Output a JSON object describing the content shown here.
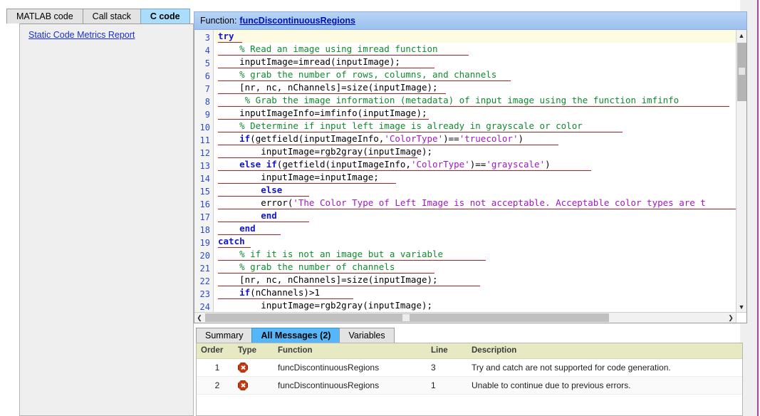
{
  "left_panel": {
    "tabs": [
      {
        "label": "MATLAB code",
        "active": false
      },
      {
        "label": "Call stack",
        "active": false
      },
      {
        "label": "C code",
        "active": true
      }
    ],
    "link": "Static Code Metrics Report"
  },
  "code_panel": {
    "header_prefix": "Function:",
    "function_name": "funcDiscontinuousRegions",
    "first_line_number": 3,
    "lines": [
      {
        "n": 3,
        "current": true,
        "underline": 34,
        "tokens": [
          {
            "t": "kw",
            "v": "try"
          }
        ]
      },
      {
        "n": 4,
        "current": false,
        "underline": 352,
        "tokens": [
          {
            "t": "cmt",
            "v": "    % Read an image using imread function"
          }
        ]
      },
      {
        "n": 5,
        "current": false,
        "underline": 304,
        "tokens": [
          {
            "t": "txt",
            "v": "    inputImage=imread(inputImage);"
          }
        ]
      },
      {
        "n": 6,
        "current": false,
        "underline": 411,
        "tokens": [
          {
            "t": "cmt",
            "v": "    % grab the number of rows, columns, and channels"
          }
        ]
      },
      {
        "n": 7,
        "current": false,
        "underline": 320,
        "tokens": [
          {
            "t": "txt",
            "v": "    [nr, nc, nChannels]=size(inputImage);"
          }
        ]
      },
      {
        "n": 8,
        "current": false,
        "underline": 718,
        "tokens": [
          {
            "t": "cmt",
            "v": "     % Grab the image information (metadata) of input image using the function imfinfo"
          }
        ]
      },
      {
        "n": 9,
        "current": false,
        "underline": 296,
        "tokens": [
          {
            "t": "txt",
            "v": "    inputImageInfo=imfinfo(inputImage);"
          }
        ]
      },
      {
        "n": 10,
        "current": false,
        "underline": 568,
        "tokens": [
          {
            "t": "cmt",
            "v": "    % Determine if input left image is already in grayscale or color"
          }
        ]
      },
      {
        "n": 11,
        "current": false,
        "underline": 478,
        "tokens": [
          {
            "t": "txt",
            "v": "    "
          },
          {
            "t": "kw",
            "v": "if"
          },
          {
            "t": "txt",
            "v": "(getfield(inputImageInfo,"
          },
          {
            "t": "str",
            "v": "'ColorType'"
          },
          {
            "t": "txt",
            "v": ")=="
          },
          {
            "t": "str",
            "v": "'truecolor'"
          },
          {
            "t": "txt",
            "v": ")"
          }
        ]
      },
      {
        "n": 12,
        "current": false,
        "underline": 280,
        "tokens": [
          {
            "t": "txt",
            "v": "        inputImage=rgb2gray(inputImage);"
          }
        ]
      },
      {
        "n": 13,
        "current": false,
        "underline": 524,
        "tokens": [
          {
            "t": "txt",
            "v": "    "
          },
          {
            "t": "kw",
            "v": "else if"
          },
          {
            "t": "txt",
            "v": "(getfield(inputImageInfo,"
          },
          {
            "t": "str",
            "v": "'ColorType'"
          },
          {
            "t": "txt",
            "v": ")=="
          },
          {
            "t": "str",
            "v": "'grayscale'"
          },
          {
            "t": "txt",
            "v": ")"
          }
        ]
      },
      {
        "n": 14,
        "current": false,
        "underline": 250,
        "tokens": [
          {
            "t": "txt",
            "v": "        inputImage=inputImage;"
          }
        ]
      },
      {
        "n": 15,
        "current": false,
        "underline": 128,
        "tokens": [
          {
            "t": "txt",
            "v": "        "
          },
          {
            "t": "kw",
            "v": "else"
          }
        ]
      },
      {
        "n": 16,
        "current": false,
        "underline": 732,
        "tokens": [
          {
            "t": "txt",
            "v": "        error("
          },
          {
            "t": "str",
            "v": "'The Color Type of Left Image is not acceptable. Acceptable color types are t"
          }
        ]
      },
      {
        "n": 17,
        "current": false,
        "underline": 128,
        "tokens": [
          {
            "t": "txt",
            "v": "        "
          },
          {
            "t": "kw",
            "v": "end"
          }
        ]
      },
      {
        "n": 18,
        "current": false,
        "underline": 88,
        "tokens": [
          {
            "t": "txt",
            "v": "    "
          },
          {
            "t": "kw",
            "v": "end"
          }
        ]
      },
      {
        "n": 19,
        "current": false,
        "underline": 46,
        "tokens": [
          {
            "t": "kw",
            "v": "catch"
          }
        ]
      },
      {
        "n": 20,
        "current": false,
        "underline": 376,
        "tokens": [
          {
            "t": "cmt",
            "v": "    % if it is not an image but a variable"
          }
        ]
      },
      {
        "n": 21,
        "current": false,
        "underline": 304,
        "tokens": [
          {
            "t": "cmt",
            "v": "    % grab the number of channels"
          }
        ]
      },
      {
        "n": 22,
        "current": false,
        "underline": 368,
        "tokens": [
          {
            "t": "txt",
            "v": "    [nr, nc, nChannels]=size(inputImage);"
          }
        ]
      },
      {
        "n": 23,
        "current": false,
        "underline": 190,
        "tokens": [
          {
            "t": "txt",
            "v": "    "
          },
          {
            "t": "kw",
            "v": "if"
          },
          {
            "t": "txt",
            "v": "(nChannels)>1"
          }
        ]
      },
      {
        "n": 24,
        "current": false,
        "underline": 0,
        "tokens": [
          {
            "t": "txt",
            "v": "        inputImage=rgb2gray(inputImage);"
          }
        ]
      }
    ],
    "scrollbars": {
      "v_up": "▲",
      "v_down": "▼",
      "h_left": "❮",
      "h_right": "❯"
    }
  },
  "messages_panel": {
    "tabs": [
      {
        "label": "Summary",
        "active": false
      },
      {
        "label": "All Messages (2)",
        "active": true
      },
      {
        "label": "Variables",
        "active": false
      }
    ],
    "columns": [
      "Order",
      "Type",
      "Function",
      "Line",
      "Description"
    ],
    "rows": [
      {
        "order": "1",
        "type_icon": "error-icon",
        "function": "funcDiscontinuousRegions",
        "line": "3",
        "description": "Try and catch are not supported for code generation."
      },
      {
        "order": "2",
        "type_icon": "error-icon",
        "function": "funcDiscontinuousRegions",
        "line": "1",
        "description": "Unable to continue due to previous errors."
      }
    ]
  },
  "colors": {
    "accent_tab": "#aadcfb",
    "accent_tab_msg": "#55b7fa",
    "header_gradient_top": "#b9d4f5",
    "link": "#1a2fd0",
    "keyword": "#1414d6",
    "string": "#a018c0",
    "comment": "#0f8a2f",
    "error": "#c23a12",
    "table_header": "#e6e9c2",
    "page_border": "#c0399f"
  }
}
